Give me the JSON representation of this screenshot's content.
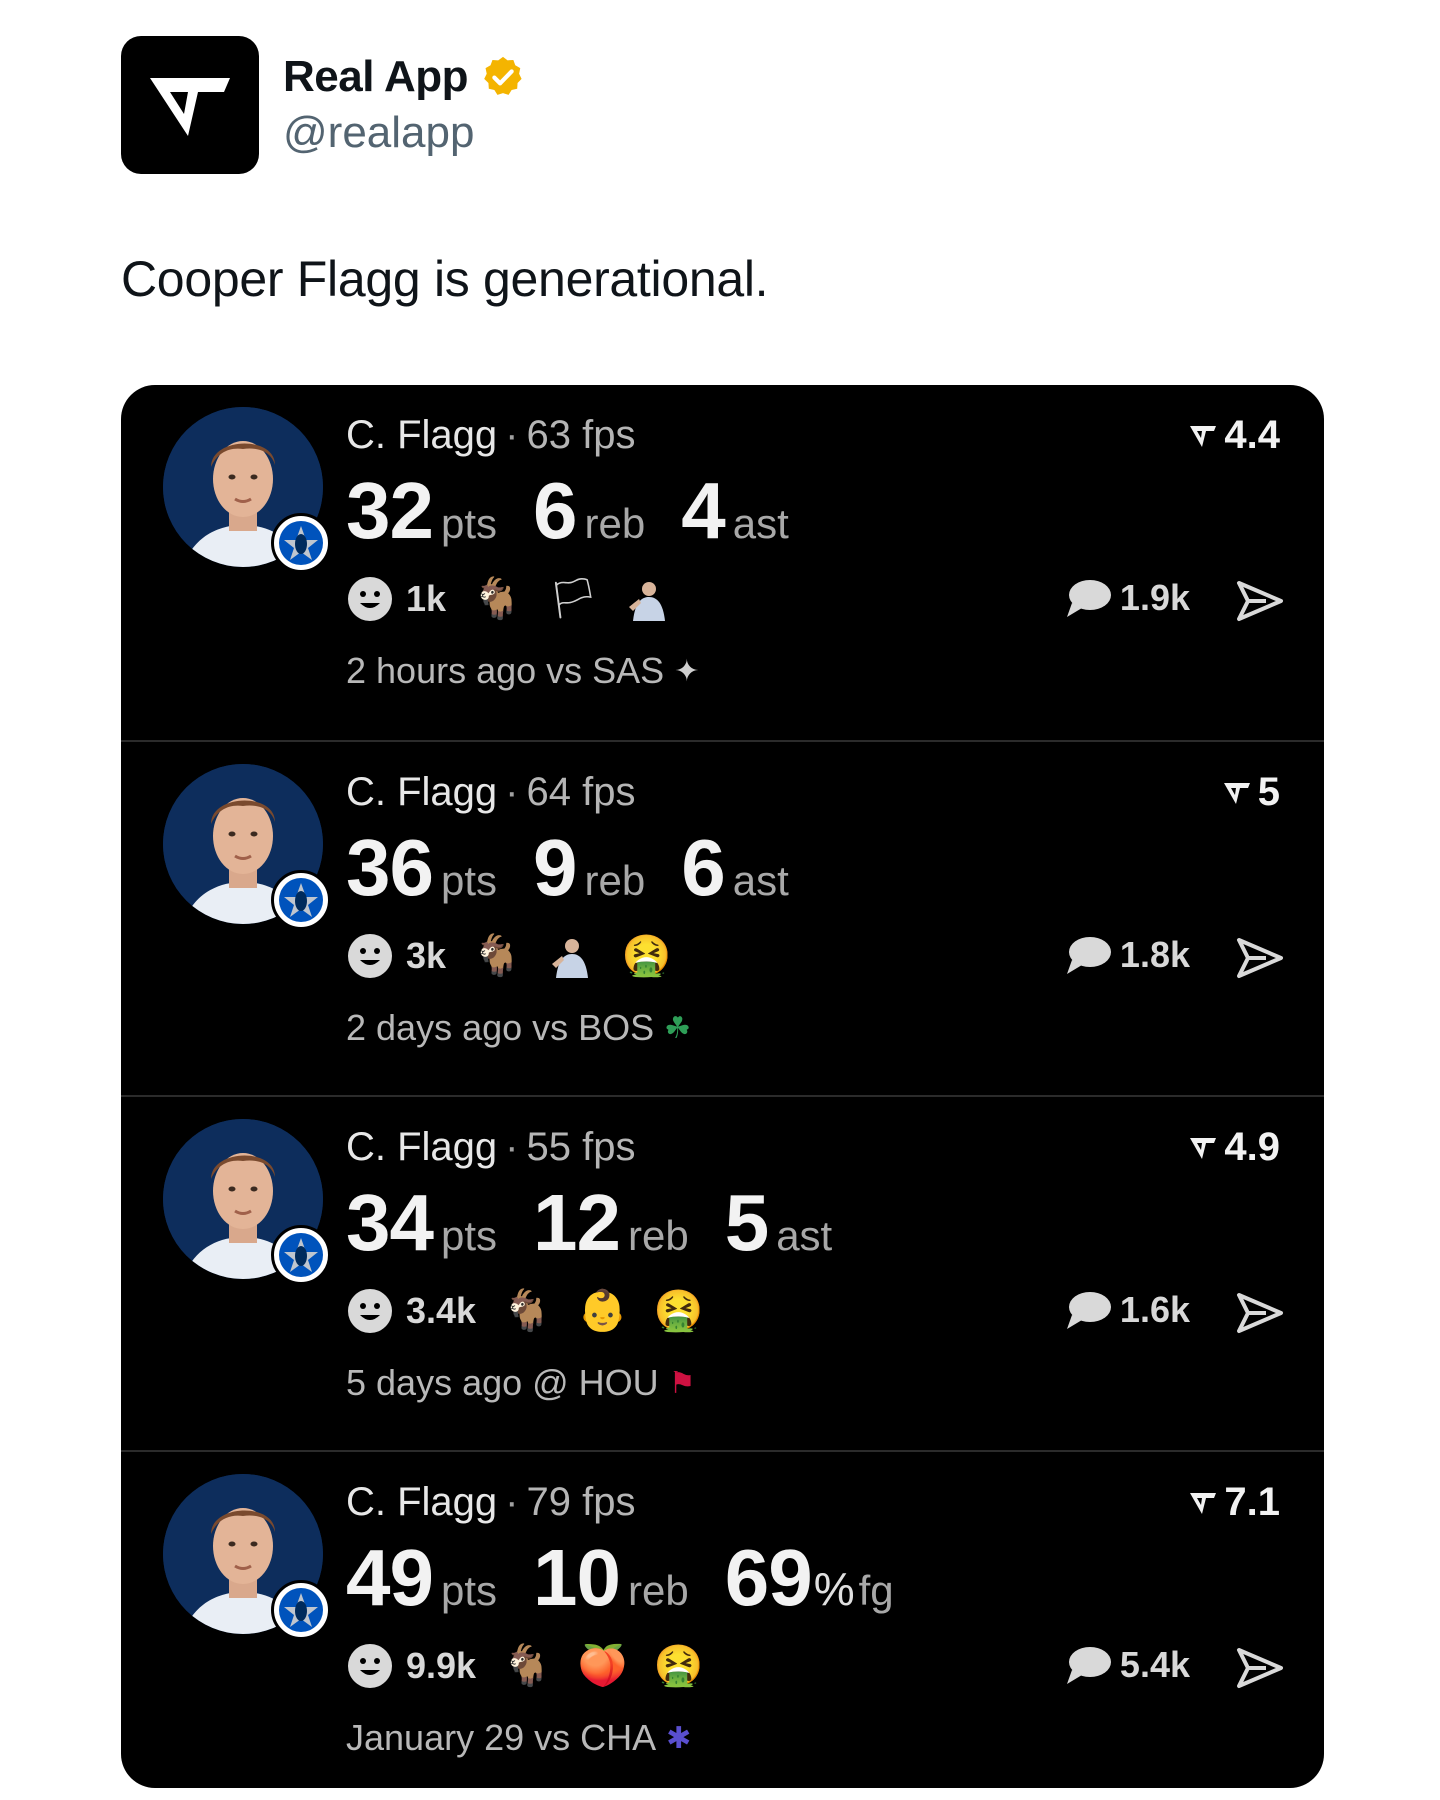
{
  "account": {
    "name": "Real App",
    "handle": "@realapp",
    "verified_color": "#f4b400"
  },
  "tweet": {
    "text": "Cooper Flagg is generational."
  },
  "games": [
    {
      "player": "C. Flagg",
      "fps": "63 fps",
      "stats": [
        {
          "value": "32",
          "unit": "pts"
        },
        {
          "value": "6",
          "unit": "reb"
        },
        {
          "value": "4",
          "unit": "ast"
        }
      ],
      "rating": "4.4",
      "reaction_count": "1k",
      "reactions": [
        "goat-emoji",
        "flag-emoji",
        "player-sticker"
      ],
      "comments": "1.9k",
      "time": "2 hours ago vs SAS",
      "opponent_logo": "spurs-logo"
    },
    {
      "player": "C. Flagg",
      "fps": "64 fps",
      "stats": [
        {
          "value": "36",
          "unit": "pts"
        },
        {
          "value": "9",
          "unit": "reb"
        },
        {
          "value": "6",
          "unit": "ast"
        }
      ],
      "rating": "5",
      "reaction_count": "3k",
      "reactions": [
        "goat-emoji",
        "player-sticker",
        "vomit-emoji"
      ],
      "comments": "1.8k",
      "time": "2 days ago vs BOS",
      "opponent_logo": "celtics-logo"
    },
    {
      "player": "C. Flagg",
      "fps": "55 fps",
      "stats": [
        {
          "value": "34",
          "unit": "pts"
        },
        {
          "value": "12",
          "unit": "reb"
        },
        {
          "value": "5",
          "unit": "ast"
        }
      ],
      "rating": "4.9",
      "reaction_count": "3.4k",
      "reactions": [
        "goat-emoji",
        "baby-emoji",
        "vomit-emoji"
      ],
      "comments": "1.6k",
      "time": "5 days ago @ HOU",
      "opponent_logo": "rockets-logo"
    },
    {
      "player": "C. Flagg",
      "fps": "79 fps",
      "stats": [
        {
          "value": "49",
          "unit": "pts"
        },
        {
          "value": "10",
          "unit": "reb"
        },
        {
          "value": "69",
          "unit": "fg",
          "prefix": "%"
        }
      ],
      "rating": "7.1",
      "reaction_count": "9.9k",
      "reactions": [
        "goat-emoji",
        "peach-emoji",
        "vomit-emoji"
      ],
      "comments": "5.4k",
      "time": "January 29 vs CHA",
      "opponent_logo": "hornets-logo"
    }
  ]
}
